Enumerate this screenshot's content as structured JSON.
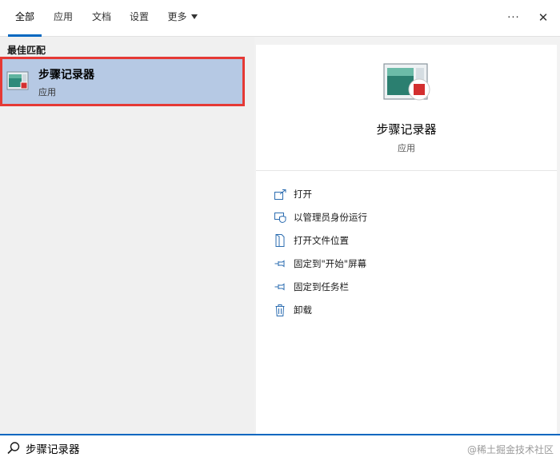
{
  "tabs": [
    {
      "label": "全部",
      "active": true
    },
    {
      "label": "应用",
      "active": false
    },
    {
      "label": "文档",
      "active": false
    },
    {
      "label": "设置",
      "active": false
    },
    {
      "label": "更多",
      "active": false,
      "has_dropdown": true
    }
  ],
  "window_controls": {
    "more_icon": "ellipsis-icon",
    "more_glyph": "···",
    "close_icon": "close-icon",
    "close_glyph": "✕"
  },
  "results": {
    "section_title": "最佳匹配",
    "best_match": {
      "name": "步骤记录器",
      "type": "应用",
      "icon": "steps-recorder-icon",
      "selected": true
    }
  },
  "detail": {
    "name": "步骤记录器",
    "type": "应用",
    "icon": "steps-recorder-icon",
    "actions": [
      {
        "label": "打开",
        "icon": "open-icon"
      },
      {
        "label": "以管理员身份运行",
        "icon": "shield-icon"
      },
      {
        "label": "打开文件位置",
        "icon": "file-location-icon"
      },
      {
        "label": "固定到\"开始\"屏幕",
        "icon": "pin-icon"
      },
      {
        "label": "固定到任务栏",
        "icon": "pin-icon"
      },
      {
        "label": "卸载",
        "icon": "trash-icon"
      }
    ]
  },
  "search": {
    "value": "步骤记录器",
    "icon": "search-icon"
  },
  "watermark": "@稀土掘金技术社区",
  "colors": {
    "accent": "#0067c0",
    "selection_bg": "#b6c9e4",
    "highlight_border": "#e53935",
    "action_icon": "#2b6cb0"
  }
}
